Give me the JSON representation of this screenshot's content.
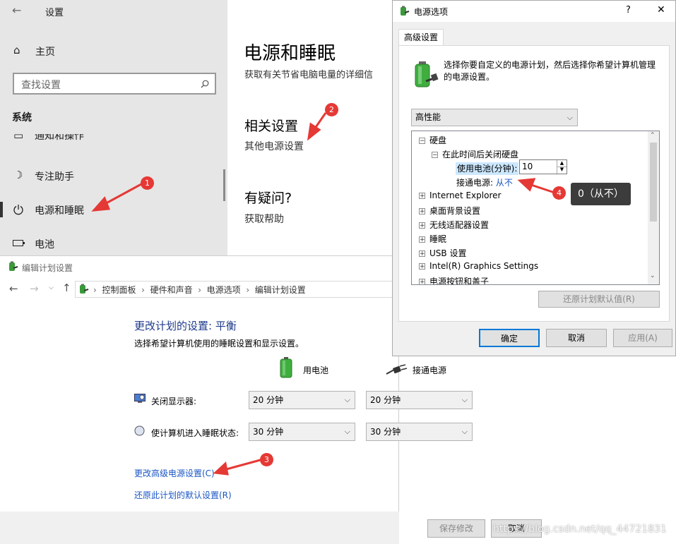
{
  "settings": {
    "title": "设置",
    "home": "主页",
    "search_placeholder": "查找设置",
    "section": "系统",
    "items": [
      {
        "label": "通知和操作",
        "icon": "notification-icon"
      },
      {
        "label": "专注助手",
        "icon": "moon-icon"
      },
      {
        "label": "电源和睡眠",
        "icon": "power-icon"
      },
      {
        "label": "电池",
        "icon": "battery-icon"
      }
    ],
    "main_title": "电源和睡眠",
    "main_desc": "获取有关节省电脑电量的详细信",
    "related_title": "相关设置",
    "related_link": "其他电源设置",
    "question_title": "有疑问?",
    "question_link": "获取帮助"
  },
  "edit_plan": {
    "title": "编辑计划设置",
    "breadcrumb": [
      "控制面板",
      "硬件和声音",
      "电源选项",
      "编辑计划设置"
    ],
    "heading": "更改计划的设置: 平衡",
    "subheading": "选择希望计算机使用的睡眠设置和显示设置。",
    "col_battery": "用电池",
    "col_plugged": "接通电源",
    "rows": [
      {
        "label": "关闭显示器:",
        "battery": "20 分钟",
        "plugged": "20 分钟"
      },
      {
        "label": "使计算机进入睡眠状态:",
        "battery": "30 分钟",
        "plugged": "30 分钟"
      }
    ],
    "link_advanced": "更改高级电源设置(C)",
    "link_restore": "还原此计划的默认设置(R)",
    "save": "保存修改",
    "cancel": "取消"
  },
  "power_dialog": {
    "title": "电源选项",
    "help": "?",
    "close": "✕",
    "tab": "高级设置",
    "desc": "选择你要自定义的电源计划，然后选择你希望计算机管理的电源设置。",
    "plan": "高性能",
    "tree": {
      "hdd": "硬盘",
      "hdd_sub": "在此时间后关闭硬盘",
      "battery_label": "使用电池(分钟):",
      "battery_value": "10",
      "plugged_label": "接通电源:",
      "plugged_value": "从不",
      "others": [
        "Internet Explorer",
        "桌面背景设置",
        "无线适配器设置",
        "睡眠",
        "USB 设置",
        "Intel(R) Graphics Settings",
        "电源按钮和盖子"
      ]
    },
    "restore_plan": "还原计划默认值(R)",
    "ok": "确定",
    "cancel": "取消",
    "apply": "应用(A)"
  },
  "annotations": {
    "badges": [
      "1",
      "2",
      "3",
      "4"
    ],
    "tooltip": "0（从不）",
    "accent": "#e53935"
  },
  "watermark": "https://blog.csdn.net/qq_44721831"
}
